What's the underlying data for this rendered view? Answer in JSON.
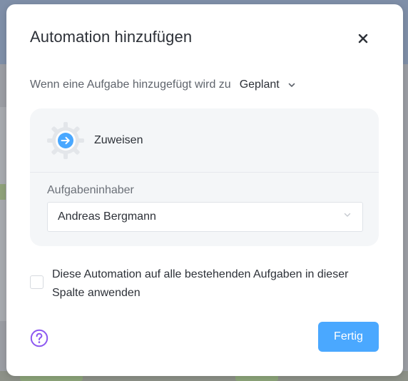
{
  "dialog": {
    "title": "Automation hinzufügen",
    "close_icon": "close-icon"
  },
  "trigger": {
    "prefix": "Wenn eine Aufgabe hinzugefügt wird zu",
    "selected": "Geplant",
    "chevron_icon": "chevron-down-icon"
  },
  "action": {
    "name": "Zuweisen",
    "icon": "gear-arrow-icon",
    "field_label": "Aufgabeninhaber",
    "field_value": "Andreas Bergmann",
    "field_chevron_icon": "chevron-down-icon"
  },
  "apply_existing": {
    "label": "Diese Automation auf alle bestehenden Aufgaben in dieser Spalte anwenden",
    "checked": false
  },
  "footer": {
    "help_icon": "help-icon",
    "done_label": "Fertig"
  },
  "colors": {
    "accent": "#4aa8ff",
    "help": "#8c57f0",
    "card_bg": "#f4f6f8"
  }
}
